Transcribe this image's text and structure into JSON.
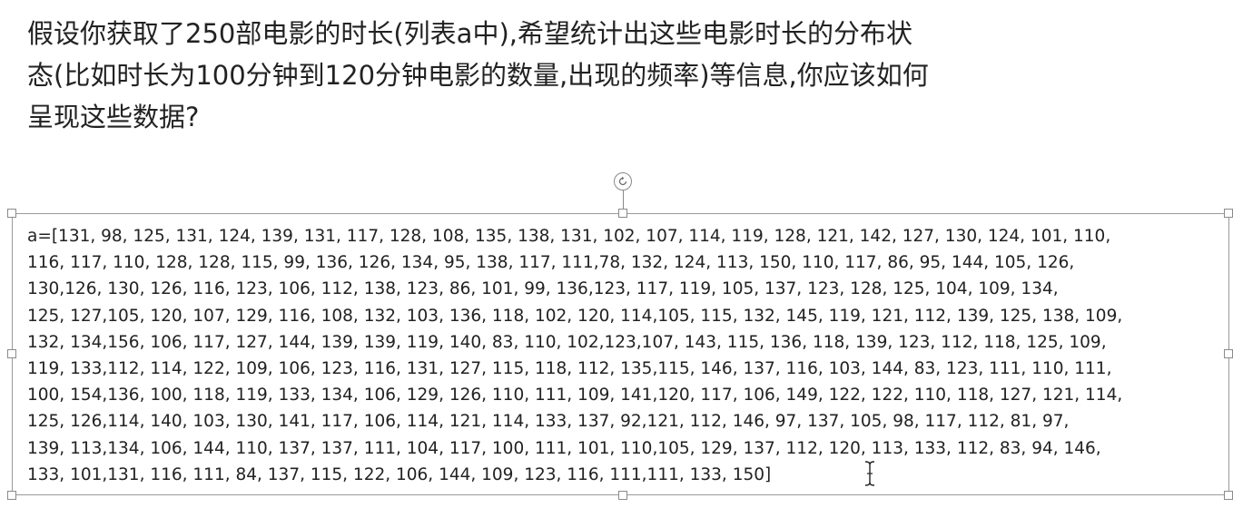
{
  "question": {
    "lines": [
      "假设你获取了250部电影的时长(列表a中),希望统计出这些电影时长的分布状",
      "态(比如时长为100分钟到120分钟电影的数量,出现的频率)等信息,你应该如何",
      "呈现这些数据?"
    ]
  },
  "text_box": {
    "lines": [
      "a=[131,  98, 125, 131, 124, 139, 131, 117, 128, 108, 135, 138, 131, 102, 107, 114, 119, 128, 121, 142, 127, 130, 124, 101, 110,",
      "116, 117, 110, 128, 128, 115,  99, 136, 126, 134,  95, 138, 117, 111,78, 132, 124, 113, 150, 110, 117,  86,  95, 144, 105, 126,",
      "130,126, 130, 126, 116, 123, 106, 112, 138, 123,  86, 101,  99, 136,123, 117, 119, 105, 137, 123, 128, 125, 104, 109, 134,",
      "125, 127,105, 120, 107, 129, 116, 108, 132, 103, 136, 118, 102, 120, 114,105, 115, 132, 145, 119, 121, 112, 139, 125, 138, 109,",
      "132, 134,156, 106, 117, 127, 144, 139, 139, 119, 140,  83, 110, 102,123,107, 143, 115, 136, 118, 139, 123, 112, 118, 125, 109,",
      "119, 133,112, 114, 122, 109, 106, 123, 116, 131, 127, 115, 118, 112, 135,115, 146, 137, 116, 103, 144,  83, 123, 111, 110, 111,",
      "100, 154,136, 100, 118, 119, 133, 134, 106, 129, 126, 110, 111, 109, 141,120, 117, 106, 149, 122, 122, 110, 118, 127, 121, 114,",
      "125, 126,114, 140, 103, 130, 141, 117, 106, 114, 121, 114, 133, 137,  92,121, 112, 146,  97, 137, 105,  98, 117, 112,  81,  97,",
      "139, 113,134, 106, 144, 110, 137, 137, 111, 104, 117, 100, 111, 101, 110,105, 129, 137, 112, 120, 113, 133, 112,  83,  94, 146,",
      "133, 101,131, 116, 111,  84, 137, 115, 122, 106, 144, 109, 123, 116, 111,111, 133, 150]"
    ]
  },
  "icons": {
    "rotate": "rotate-handle-icon",
    "cursor": "text-cursor-icon"
  },
  "colors": {
    "text": "#222222",
    "border": "#9a9a9a",
    "handle": "#8a8a8a"
  }
}
